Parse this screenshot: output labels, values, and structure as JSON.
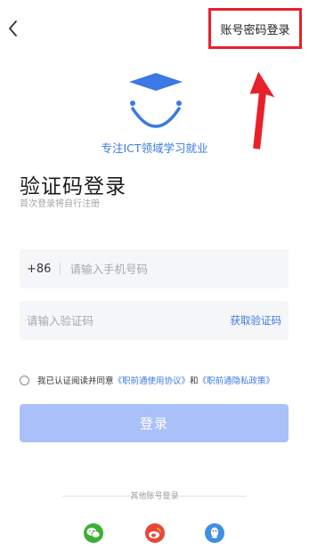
{
  "topbar": {
    "back_icon": "chevron-left-icon",
    "account_login_label": "账号密码登录"
  },
  "logo": {
    "icon": "graduation-smile-logo",
    "slogan": "专注ICT领域学习就业"
  },
  "header": {
    "title": "验证码登录",
    "subtitle": "首次登录将自行注册"
  },
  "phone": {
    "country_code": "+86",
    "placeholder": "请输入手机号码",
    "value": ""
  },
  "code": {
    "placeholder": "请输入验证码",
    "value": "",
    "get_code_label": "获取验证码"
  },
  "agreement": {
    "prefix": "我已认证阅读并同意",
    "user_agreement": "《职前通使用协议》",
    "and": "和",
    "privacy_policy": "《职前通隐私政策》",
    "checked": false
  },
  "login_button": {
    "label": "登录"
  },
  "other_login": {
    "label": "其他账号登录",
    "options": [
      "wechat-icon",
      "weibo-icon",
      "qq-icon"
    ]
  },
  "colors": {
    "accent": "#3a79e6",
    "button_disabled": "#a9c1f8",
    "highlight_red": "#e8202a",
    "wechat": "#3cb034",
    "weibo": "#e8473a",
    "qq": "#3f8ee6"
  }
}
